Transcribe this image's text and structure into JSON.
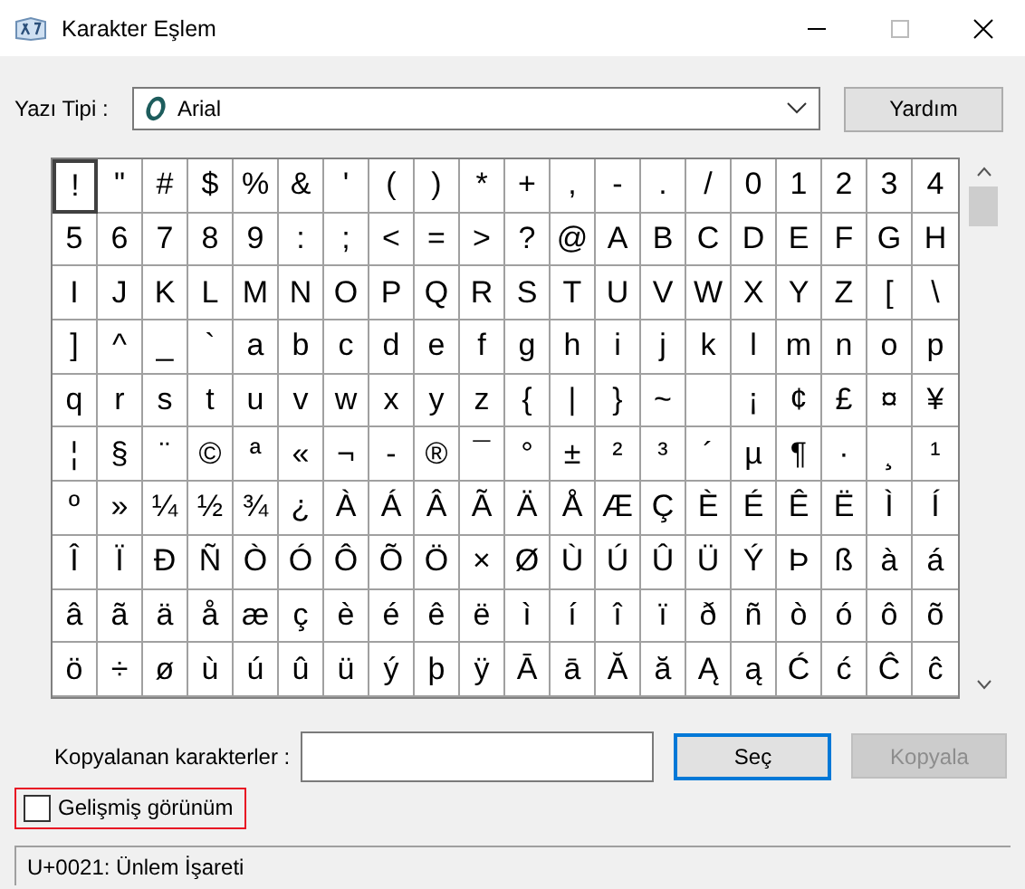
{
  "window": {
    "title": "Karakter Eşlem"
  },
  "font": {
    "label": "Yazı Tipi :",
    "value": "Arial",
    "help_button": "Yardım"
  },
  "grid": {
    "rows": [
      [
        {
          "c": "!",
          "selected": true
        },
        {
          "c": "\"",
          "selected": false
        },
        {
          "c": "#",
          "selected": false
        },
        {
          "c": "$",
          "selected": false
        },
        {
          "c": "%",
          "selected": false
        },
        {
          "c": "&",
          "selected": false
        },
        {
          "c": "'",
          "selected": false
        },
        {
          "c": "(",
          "selected": false
        },
        {
          "c": ")",
          "selected": false
        },
        {
          "c": "*",
          "selected": false
        },
        {
          "c": "+",
          "selected": false
        },
        {
          "c": ",",
          "selected": false
        },
        {
          "c": "-",
          "selected": false
        },
        {
          "c": ".",
          "selected": false
        },
        {
          "c": "/",
          "selected": false
        },
        {
          "c": "0",
          "selected": false
        },
        {
          "c": "1",
          "selected": false
        },
        {
          "c": "2",
          "selected": false
        },
        {
          "c": "3",
          "selected": false
        },
        {
          "c": "4",
          "selected": false
        }
      ],
      [
        {
          "c": "5",
          "selected": false
        },
        {
          "c": "6",
          "selected": false
        },
        {
          "c": "7",
          "selected": false
        },
        {
          "c": "8",
          "selected": false
        },
        {
          "c": "9",
          "selected": false
        },
        {
          "c": ":",
          "selected": false
        },
        {
          "c": ";",
          "selected": false
        },
        {
          "c": "<",
          "selected": false
        },
        {
          "c": "=",
          "selected": false
        },
        {
          "c": ">",
          "selected": false
        },
        {
          "c": "?",
          "selected": false
        },
        {
          "c": "@",
          "selected": false
        },
        {
          "c": "A",
          "selected": false
        },
        {
          "c": "B",
          "selected": false
        },
        {
          "c": "C",
          "selected": false
        },
        {
          "c": "D",
          "selected": false
        },
        {
          "c": "E",
          "selected": false
        },
        {
          "c": "F",
          "selected": false
        },
        {
          "c": "G",
          "selected": false
        },
        {
          "c": "H",
          "selected": false
        }
      ],
      [
        {
          "c": "I",
          "selected": false
        },
        {
          "c": "J",
          "selected": false
        },
        {
          "c": "K",
          "selected": false
        },
        {
          "c": "L",
          "selected": false
        },
        {
          "c": "M",
          "selected": false
        },
        {
          "c": "N",
          "selected": false
        },
        {
          "c": "O",
          "selected": false
        },
        {
          "c": "P",
          "selected": false
        },
        {
          "c": "Q",
          "selected": false
        },
        {
          "c": "R",
          "selected": false
        },
        {
          "c": "S",
          "selected": false
        },
        {
          "c": "T",
          "selected": false
        },
        {
          "c": "U",
          "selected": false
        },
        {
          "c": "V",
          "selected": false
        },
        {
          "c": "W",
          "selected": false
        },
        {
          "c": "X",
          "selected": false
        },
        {
          "c": "Y",
          "selected": false
        },
        {
          "c": "Z",
          "selected": false
        },
        {
          "c": "[",
          "selected": false
        },
        {
          "c": "\\",
          "selected": false
        }
      ],
      [
        {
          "c": "]",
          "selected": false
        },
        {
          "c": "^",
          "selected": false
        },
        {
          "c": "_",
          "selected": false
        },
        {
          "c": "`",
          "selected": false
        },
        {
          "c": "a",
          "selected": false
        },
        {
          "c": "b",
          "selected": false
        },
        {
          "c": "c",
          "selected": false
        },
        {
          "c": "d",
          "selected": false
        },
        {
          "c": "e",
          "selected": false
        },
        {
          "c": "f",
          "selected": false
        },
        {
          "c": "g",
          "selected": false
        },
        {
          "c": "h",
          "selected": false
        },
        {
          "c": "i",
          "selected": false
        },
        {
          "c": "j",
          "selected": false
        },
        {
          "c": "k",
          "selected": false
        },
        {
          "c": "l",
          "selected": false
        },
        {
          "c": "m",
          "selected": false
        },
        {
          "c": "n",
          "selected": false
        },
        {
          "c": "o",
          "selected": false
        },
        {
          "c": "p",
          "selected": false
        }
      ],
      [
        {
          "c": "q",
          "selected": false
        },
        {
          "c": "r",
          "selected": false
        },
        {
          "c": "s",
          "selected": false
        },
        {
          "c": "t",
          "selected": false
        },
        {
          "c": "u",
          "selected": false
        },
        {
          "c": "v",
          "selected": false
        },
        {
          "c": "w",
          "selected": false
        },
        {
          "c": "x",
          "selected": false
        },
        {
          "c": "y",
          "selected": false
        },
        {
          "c": "z",
          "selected": false
        },
        {
          "c": "{",
          "selected": false
        },
        {
          "c": "|",
          "selected": false
        },
        {
          "c": "}",
          "selected": false
        },
        {
          "c": "~",
          "selected": false
        },
        {
          "selected": false
        },
        {
          "c": "¡",
          "selected": false
        },
        {
          "c": "¢",
          "selected": false
        },
        {
          "c": "£",
          "selected": false
        },
        {
          "c": "¤",
          "selected": false
        },
        {
          "c": "¥",
          "selected": false
        }
      ],
      [
        {
          "c": "¦",
          "selected": false
        },
        {
          "c": "§",
          "selected": false
        },
        {
          "c": "¨",
          "selected": false
        },
        {
          "c": "©",
          "selected": false
        },
        {
          "c": "ª",
          "selected": false
        },
        {
          "c": "«",
          "selected": false
        },
        {
          "c": "¬",
          "selected": false
        },
        {
          "c": "-",
          "selected": false
        },
        {
          "c": "®",
          "selected": false
        },
        {
          "c": "¯",
          "selected": false
        },
        {
          "c": "°",
          "selected": false
        },
        {
          "c": "±",
          "selected": false
        },
        {
          "c": "²",
          "selected": false
        },
        {
          "c": "³",
          "selected": false
        },
        {
          "c": "´",
          "selected": false
        },
        {
          "c": "µ",
          "selected": false
        },
        {
          "c": "¶",
          "selected": false
        },
        {
          "c": "·",
          "selected": false
        },
        {
          "c": "¸",
          "selected": false
        },
        {
          "c": "¹",
          "selected": false
        }
      ],
      [
        {
          "c": "º",
          "selected": false
        },
        {
          "c": "»",
          "selected": false
        },
        {
          "c": "¼",
          "selected": false
        },
        {
          "c": "½",
          "selected": false
        },
        {
          "c": "¾",
          "selected": false
        },
        {
          "c": "¿",
          "selected": false
        },
        {
          "c": "À",
          "selected": false
        },
        {
          "c": "Á",
          "selected": false
        },
        {
          "c": "Â",
          "selected": false
        },
        {
          "c": "Ã",
          "selected": false
        },
        {
          "c": "Ä",
          "selected": false
        },
        {
          "c": "Å",
          "selected": false
        },
        {
          "c": "Æ",
          "selected": false
        },
        {
          "c": "Ç",
          "selected": false
        },
        {
          "c": "È",
          "selected": false
        },
        {
          "c": "É",
          "selected": false
        },
        {
          "c": "Ê",
          "selected": false
        },
        {
          "c": "Ë",
          "selected": false
        },
        {
          "c": "Ì",
          "selected": false
        },
        {
          "c": "Í",
          "selected": false
        }
      ],
      [
        {
          "c": "Î",
          "selected": false
        },
        {
          "c": "Ï",
          "selected": false
        },
        {
          "c": "Ð",
          "selected": false
        },
        {
          "c": "Ñ",
          "selected": false
        },
        {
          "c": "Ò",
          "selected": false
        },
        {
          "c": "Ó",
          "selected": false
        },
        {
          "c": "Ô",
          "selected": false
        },
        {
          "c": "Õ",
          "selected": false
        },
        {
          "c": "Ö",
          "selected": false
        },
        {
          "c": "×",
          "selected": false
        },
        {
          "c": "Ø",
          "selected": false
        },
        {
          "c": "Ù",
          "selected": false
        },
        {
          "c": "Ú",
          "selected": false
        },
        {
          "c": "Û",
          "selected": false
        },
        {
          "c": "Ü",
          "selected": false
        },
        {
          "c": "Ý",
          "selected": false
        },
        {
          "c": "Þ",
          "selected": false
        },
        {
          "c": "ß",
          "selected": false
        },
        {
          "c": "à",
          "selected": false
        },
        {
          "c": "á",
          "selected": false
        }
      ],
      [
        {
          "c": "â",
          "selected": false
        },
        {
          "c": "ã",
          "selected": false
        },
        {
          "c": "ä",
          "selected": false
        },
        {
          "c": "å",
          "selected": false
        },
        {
          "c": "æ",
          "selected": false
        },
        {
          "c": "ç",
          "selected": false
        },
        {
          "c": "è",
          "selected": false
        },
        {
          "c": "é",
          "selected": false
        },
        {
          "c": "ê",
          "selected": false
        },
        {
          "c": "ë",
          "selected": false
        },
        {
          "c": "ì",
          "selected": false
        },
        {
          "c": "í",
          "selected": false
        },
        {
          "c": "î",
          "selected": false
        },
        {
          "c": "ï",
          "selected": false
        },
        {
          "c": "ð",
          "selected": false
        },
        {
          "c": "ñ",
          "selected": false
        },
        {
          "c": "ò",
          "selected": false
        },
        {
          "c": "ó",
          "selected": false
        },
        {
          "c": "ô",
          "selected": false
        },
        {
          "c": "õ",
          "selected": false
        }
      ],
      [
        {
          "c": "ö",
          "selected": false
        },
        {
          "c": "÷",
          "selected": false
        },
        {
          "c": "ø",
          "selected": false
        },
        {
          "c": "ù",
          "selected": false
        },
        {
          "c": "ú",
          "selected": false
        },
        {
          "c": "û",
          "selected": false
        },
        {
          "c": "ü",
          "selected": false
        },
        {
          "c": "ý",
          "selected": false
        },
        {
          "c": "þ",
          "selected": false
        },
        {
          "c": "ÿ",
          "selected": false
        },
        {
          "c": "Ā",
          "selected": false
        },
        {
          "c": "ā",
          "selected": false
        },
        {
          "c": "Ă",
          "selected": false
        },
        {
          "c": "ă",
          "selected": false
        },
        {
          "c": "Ą",
          "selected": false
        },
        {
          "c": "ą",
          "selected": false
        },
        {
          "c": "Ć",
          "selected": false
        },
        {
          "c": "ć",
          "selected": false
        },
        {
          "c": "Ĉ",
          "selected": false
        },
        {
          "c": "ĉ",
          "selected": false
        }
      ]
    ]
  },
  "copy": {
    "label": "Kopyalanan karakterler :",
    "select_button": "Seç",
    "copy_button": {
      "label": "Kopyala",
      "disabled": true
    }
  },
  "advanced_view": {
    "label": "Gelişmiş görünüm",
    "checked": false,
    "highlighted": true
  },
  "status_bar": "U+0021: Ünlem İşareti"
}
